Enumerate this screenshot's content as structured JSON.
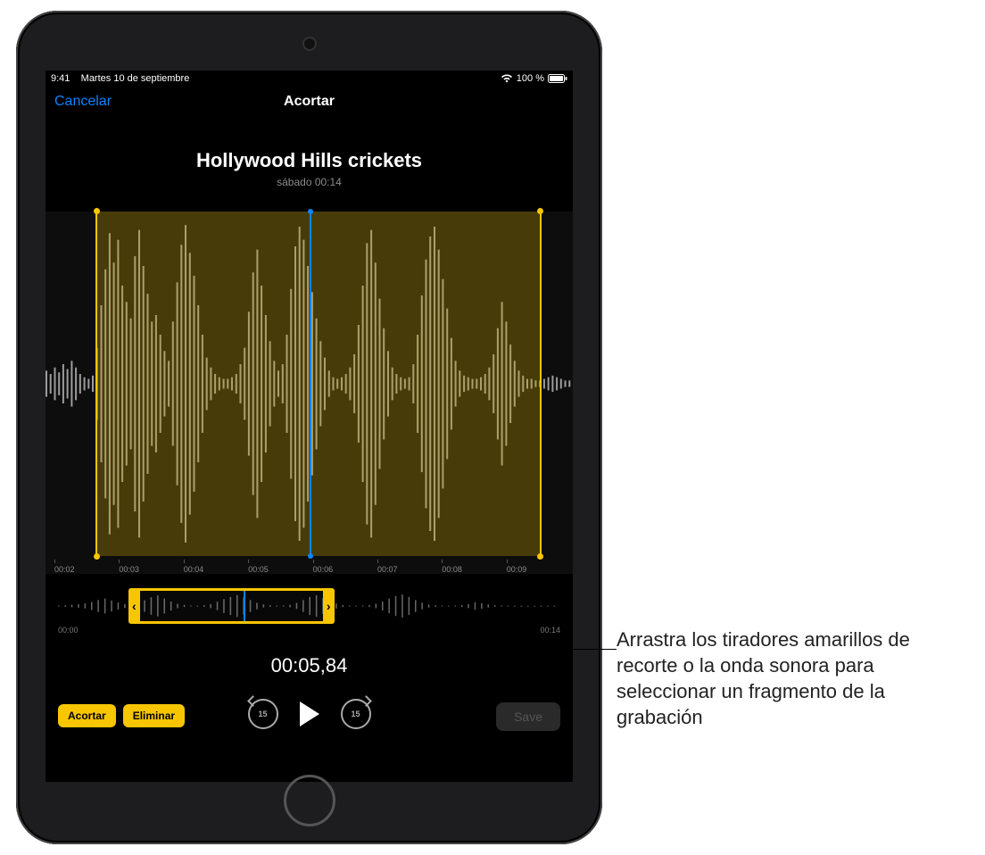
{
  "status_bar": {
    "time": "9:41",
    "date": "Martes 10 de septiembre",
    "battery_text": "100 %",
    "wifi_icon": "wifi",
    "battery_icon": "battery-full"
  },
  "nav": {
    "cancel_label": "Cancelar",
    "title": "Acortar"
  },
  "recording": {
    "title": "Hollywood Hills crickets",
    "subtitle": "sábado  00:14"
  },
  "big_waveform": {
    "ruler_ticks": [
      "00:02",
      "00:03",
      "00:04",
      "00:05",
      "00:06",
      "00:07",
      "00:08",
      "00:09"
    ],
    "selection_start_pct": 9.5,
    "selection_end_pct": 94,
    "playhead_pct": 50,
    "amplitudes": [
      8,
      6,
      10,
      7,
      12,
      9,
      14,
      10,
      6,
      4,
      3,
      5,
      22,
      48,
      70,
      92,
      74,
      88,
      60,
      50,
      40,
      78,
      94,
      72,
      55,
      38,
      42,
      30,
      20,
      14,
      38,
      62,
      85,
      97,
      80,
      66,
      48,
      30,
      16,
      10,
      6,
      4,
      3,
      3,
      4,
      6,
      12,
      22,
      44,
      68,
      82,
      60,
      42,
      26,
      14,
      8,
      12,
      30,
      58,
      84,
      96,
      88,
      72,
      56,
      40,
      26,
      16,
      8,
      4,
      3,
      4,
      6,
      10,
      18,
      36,
      60,
      86,
      94,
      74,
      52,
      34,
      20,
      10,
      6,
      4,
      3,
      4,
      12,
      30,
      54,
      76,
      90,
      96,
      82,
      64,
      46,
      28,
      14,
      8,
      5,
      4,
      3,
      3,
      4,
      6,
      10,
      18,
      34,
      50,
      38,
      24,
      14,
      8,
      5,
      3,
      3,
      2,
      2,
      3,
      4,
      5,
      4,
      3,
      2,
      2
    ]
  },
  "overview": {
    "start_label": "00:00",
    "end_label": "00:14",
    "selection_start_pct": 14,
    "selection_end_pct": 55,
    "playhead_pct": 37,
    "amplitudes": [
      4,
      6,
      10,
      14,
      20,
      32,
      48,
      60,
      44,
      28,
      16,
      8,
      22,
      46,
      70,
      84,
      60,
      36,
      18,
      8,
      4,
      3,
      6,
      16,
      34,
      56,
      72,
      88,
      70,
      48,
      26,
      12,
      6,
      3,
      4,
      10,
      24,
      48,
      72,
      86,
      64,
      40,
      20,
      8,
      4,
      3,
      4,
      8,
      18,
      36,
      58,
      80,
      92,
      72,
      48,
      26,
      12,
      6,
      3,
      3,
      4,
      8,
      16,
      30,
      22,
      12,
      6,
      4,
      3,
      2,
      2,
      2,
      2,
      2,
      2,
      2
    ]
  },
  "timecode": "00:05,84",
  "controls": {
    "trim_label": "Acortar",
    "delete_label": "Eliminar",
    "skip_back_value": "15",
    "skip_fwd_value": "15",
    "save_label": "Save"
  },
  "callout": {
    "text": "Arrastra los tiradores amarillos de recorte o la onda sonora para seleccionar un fragmento de la grabación"
  }
}
